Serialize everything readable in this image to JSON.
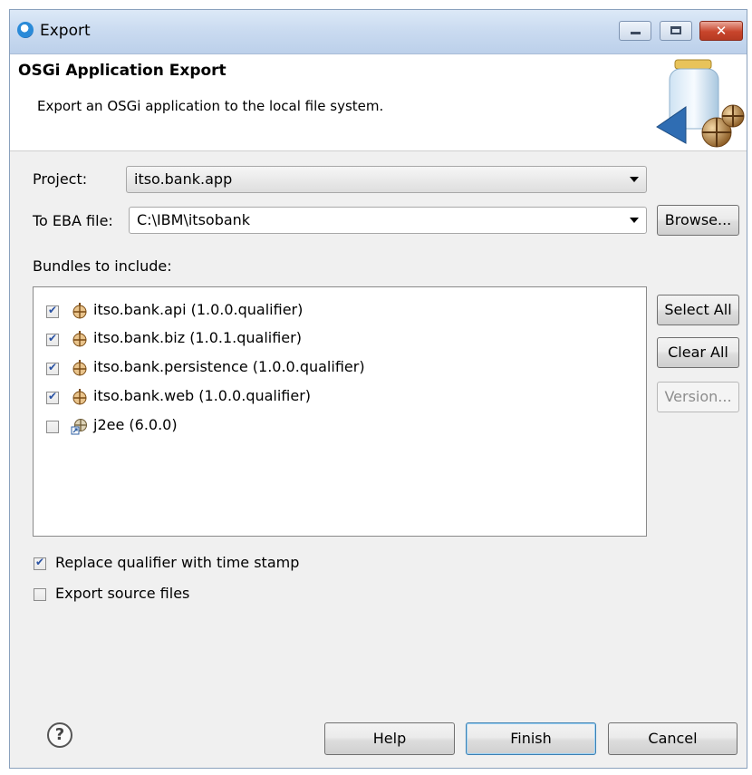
{
  "window": {
    "title": "Export",
    "buttons": {
      "minimize": "minimize",
      "maximize": "maximize",
      "close": "close"
    }
  },
  "banner": {
    "title": "OSGi Application Export",
    "description": "Export an OSGi application to the local file system."
  },
  "form": {
    "project_label": "Project:",
    "project_value": "itso.bank.app",
    "eba_label": "To EBA file:",
    "eba_value": "C:\\IBM\\itsobank",
    "browse_label": "Browse...",
    "bundles_label": "Bundles to include:"
  },
  "bundles": [
    {
      "label": "itso.bank.api (1.0.0.qualifier)",
      "checked": true,
      "icon": "bundle-icon"
    },
    {
      "label": "itso.bank.biz (1.0.1.qualifier)",
      "checked": true,
      "icon": "bundle-icon"
    },
    {
      "label": "itso.bank.persistence (1.0.0.qualifier)",
      "checked": true,
      "icon": "bundle-icon"
    },
    {
      "label": "itso.bank.web (1.0.0.qualifier)",
      "checked": true,
      "icon": "bundle-icon"
    },
    {
      "label": "j2ee (6.0.0)",
      "checked": false,
      "icon": "imported-bundle-icon"
    }
  ],
  "side_buttons": {
    "select_all": "Select All",
    "clear_all": "Clear All",
    "version": "Version..."
  },
  "options": {
    "replace_qualifier": {
      "label": "Replace qualifier with time stamp",
      "checked": true
    },
    "export_source": {
      "label": "Export source files",
      "checked": false
    }
  },
  "footer": {
    "help_icon": "?",
    "help_label": "Help",
    "finish_label": "Finish",
    "cancel_label": "Cancel"
  },
  "colors": {
    "titlebar": "#c9daf0",
    "close_button": "#c8452c",
    "checkmark": "#2a52a3",
    "default_button_border": "#3c7fb1"
  }
}
